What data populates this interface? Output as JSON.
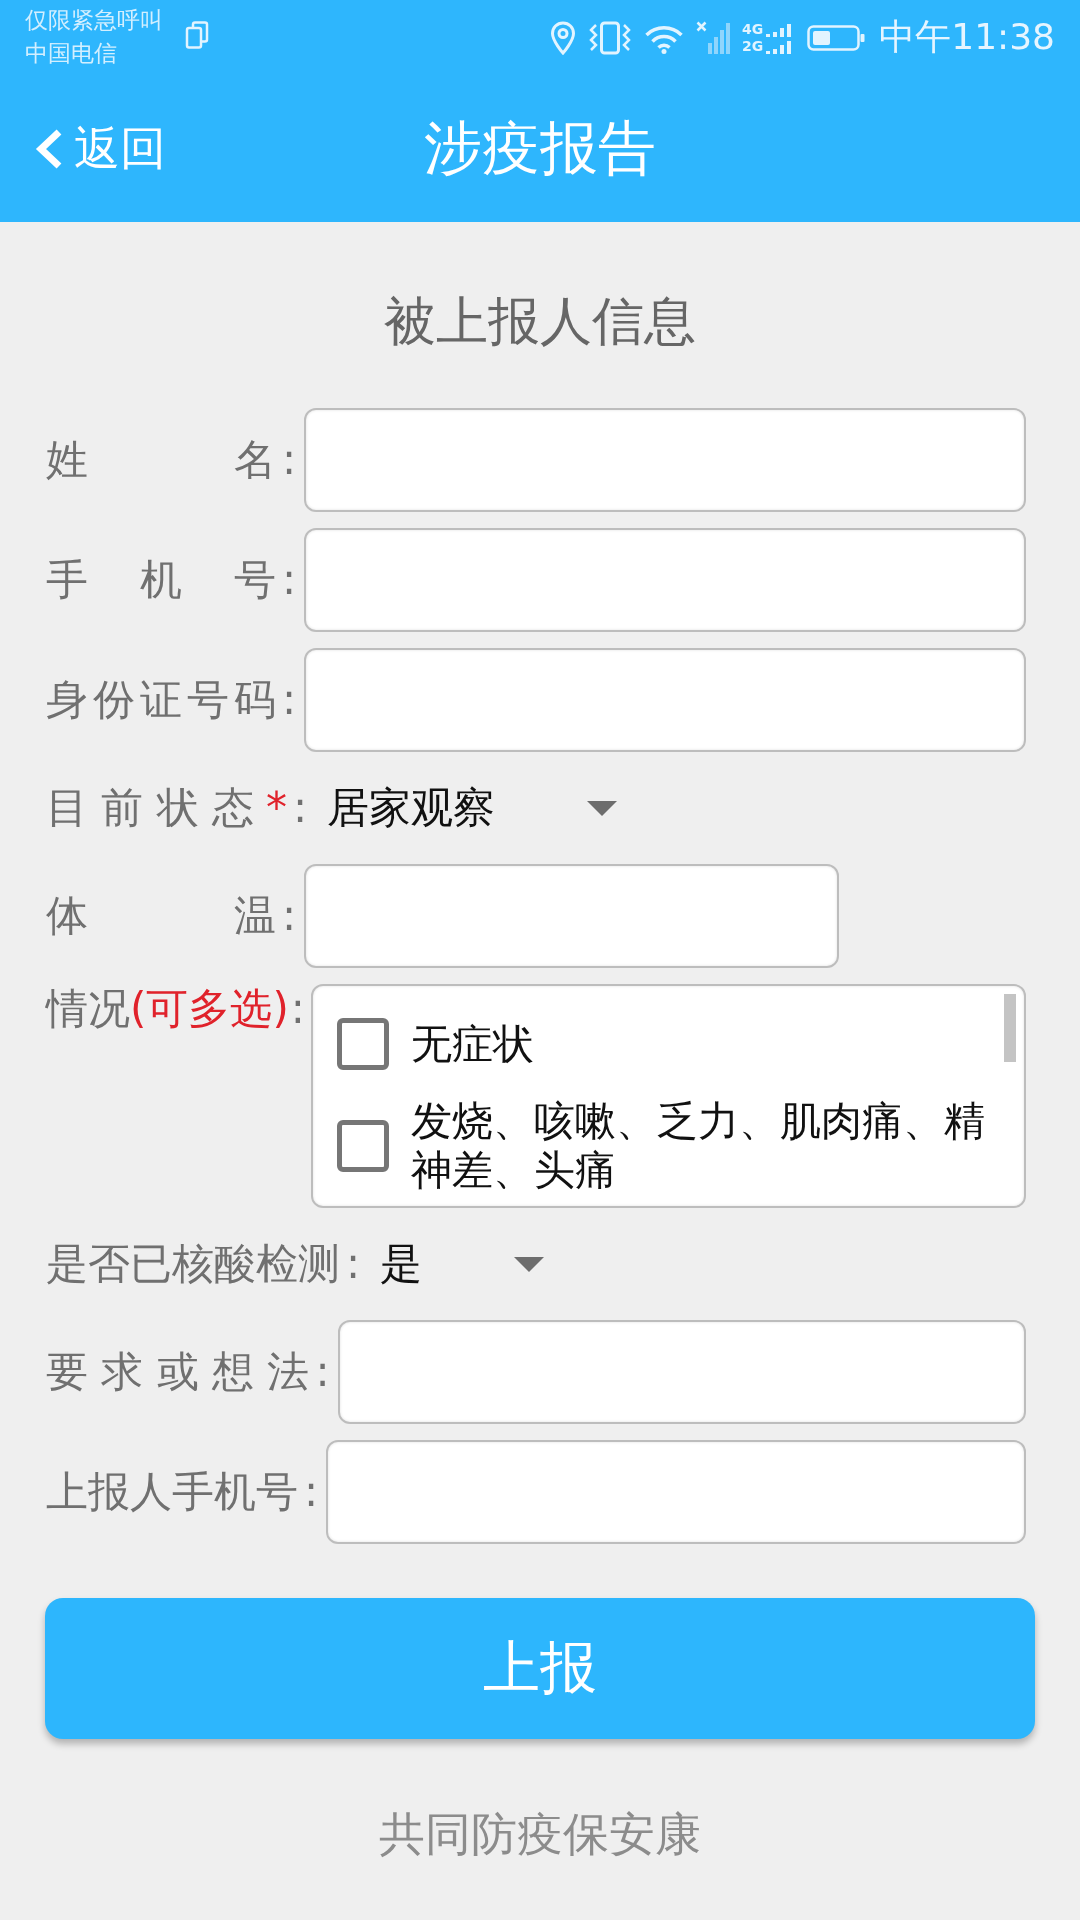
{
  "status_bar": {
    "carrier_lines": [
      "仅限紧急呼叫",
      "中国电信"
    ],
    "network_types": [
      "4G",
      "2G"
    ],
    "time": "中午11:38"
  },
  "header": {
    "back_label": "返回",
    "title": "涉疫报告"
  },
  "form": {
    "heading": "被上报人信息",
    "fields": [
      {
        "kind": "text",
        "label": "姓 名",
        "colon": ":"
      },
      {
        "kind": "text",
        "label": "手 机 号",
        "colon": ":"
      },
      {
        "kind": "text",
        "label": "身份证号码",
        "colon": ":"
      },
      {
        "kind": "dropdown",
        "label": "目 前 状 态",
        "marker": "*",
        "colon": ":",
        "value": "居家观察"
      },
      {
        "kind": "number",
        "label": "体 温",
        "colon": ":"
      },
      {
        "kind": "checklist",
        "label": "情况",
        "marker": "(可多选)",
        "colon": ":",
        "options": [
          {
            "label": "无症状",
            "checked": false
          },
          {
            "label": "发烧、咳嗽、乏力、肌肉痛、精神差、头痛",
            "checked": false
          }
        ]
      },
      {
        "kind": "dropdown",
        "label": "是否已核酸检测",
        "colon": ":",
        "value": "是"
      },
      {
        "kind": "text",
        "label": "要 求 或 想 法",
        "colon": ":"
      },
      {
        "kind": "text",
        "label": "上报人手机号",
        "colon": ":"
      }
    ],
    "submit": "上报"
  },
  "footer": "共同防疫保安康"
}
